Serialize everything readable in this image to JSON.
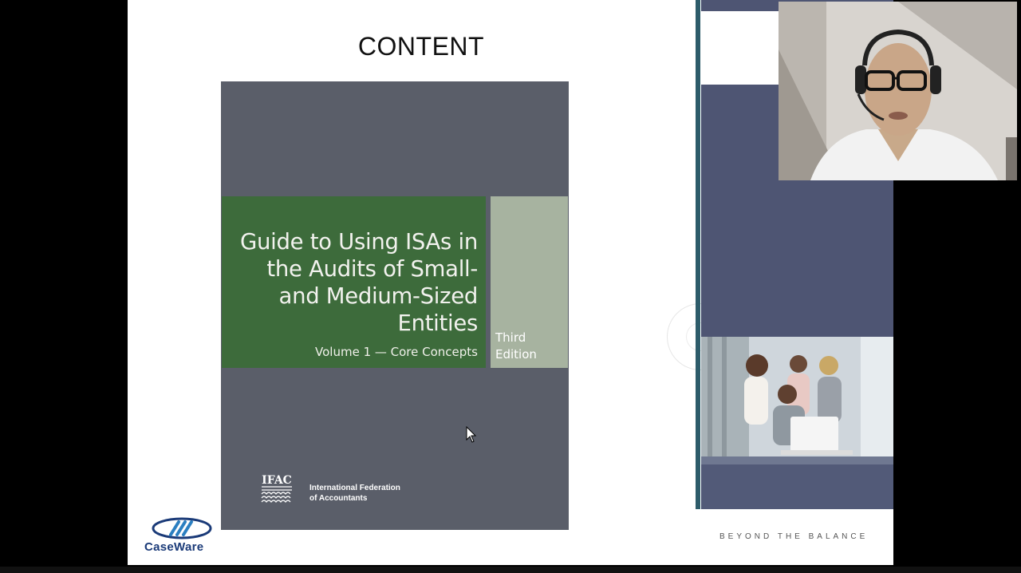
{
  "slide": {
    "title": "CONTENT",
    "tagline": "BEYOND THE BALANCE",
    "logo_text": "CaseWare"
  },
  "book_cover": {
    "title": "Guide to Using ISAs in the Audits of Small- and Medium-Sized Entities",
    "title_lines": [
      "Guide to Using ISAs in",
      "the Audits of Small-",
      "and Medium-Sized",
      "Entities"
    ],
    "volume": "Volume 1 — Core Concepts",
    "edition_lines": [
      "Third",
      "Edition"
    ],
    "publisher_logo": "IFAC",
    "publisher_lines": [
      "International Federation",
      "of Accountants"
    ],
    "colors": {
      "cover": "#5a5e69",
      "green": "#3d6b3b",
      "side": "#a7b3a0"
    }
  },
  "colors": {
    "accent": "#2d5c6a",
    "panel_blue": "#4e5573",
    "brand_blue": "#1a3a78"
  },
  "icons": {
    "cursor": "mouse-pointer-icon"
  }
}
